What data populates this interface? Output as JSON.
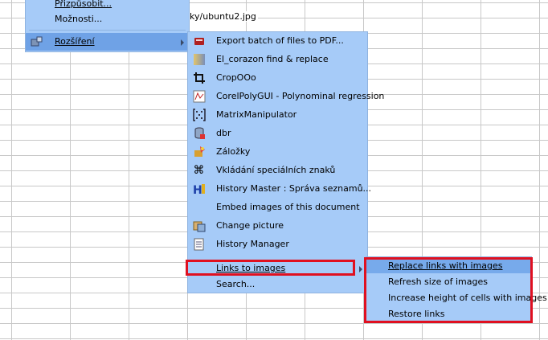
{
  "sheet": {
    "cell_text": "ky/ubuntu2.jpg"
  },
  "main_menu": {
    "items": [
      {
        "label": "Přizpůsobit...",
        "icon": ""
      },
      {
        "label": "Možnosti...",
        "icon": ""
      },
      {
        "label": "Rozšíření",
        "icon": "extensions-icon",
        "highlighted": true,
        "has_submenu": true
      }
    ]
  },
  "extensions_menu": {
    "items": [
      {
        "label": "Export batch of files to PDF...",
        "icon": "pdf-export-icon"
      },
      {
        "label": "El_corazon find & replace",
        "icon": "find-replace-icon"
      },
      {
        "label": "CropOOo",
        "icon": "crop-icon"
      },
      {
        "label": "CorelPolyGUI - Polynominal regression",
        "icon": "regression-chart-icon"
      },
      {
        "label": "MatrixManipulator",
        "icon": "matrix-icon"
      },
      {
        "label": "dbr",
        "icon": "database-icon"
      },
      {
        "label": "Záložky",
        "icon": "bookmark-icon"
      },
      {
        "label": "Vkládání speciálních znaků",
        "icon": "special-chars-icon"
      },
      {
        "label": "History Master : Správa seznamů...",
        "icon": "history-master-icon"
      },
      {
        "label": "Embed images of this document",
        "icon": ""
      },
      {
        "label": "Change picture",
        "icon": "change-picture-icon"
      },
      {
        "label": "History Manager",
        "icon": "history-manager-icon"
      },
      {
        "label": "Links to images",
        "icon": "",
        "has_submenu": true
      },
      {
        "label": "Search...",
        "icon": ""
      }
    ]
  },
  "links_menu": {
    "items": [
      {
        "label": "Replace links with images",
        "highlighted": true
      },
      {
        "label": "Refresh size of images"
      },
      {
        "label": "Increase height of cells with images"
      },
      {
        "label": "Restore links"
      }
    ]
  },
  "colors": {
    "menu_bg": "#a6cbf8",
    "highlight": "#6fa2e6",
    "annotation_red": "#e01020"
  }
}
